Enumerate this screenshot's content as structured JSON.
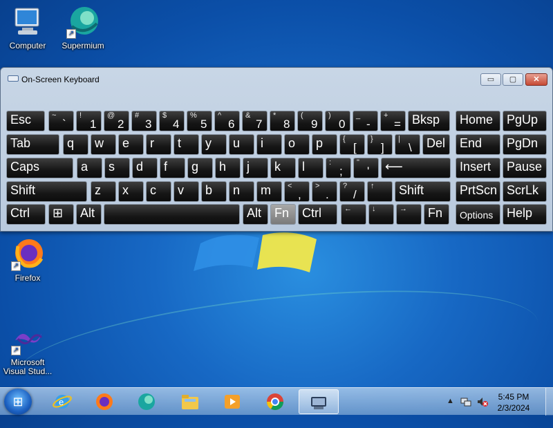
{
  "desktop": {
    "icons": [
      {
        "label": "Computer"
      },
      {
        "label": "Supermium"
      },
      {
        "label": "Firefox"
      },
      {
        "label": "Microsoft Visual Stud..."
      }
    ]
  },
  "osk": {
    "title": "On-Screen Keyboard",
    "controls": {
      "minimize": "▭",
      "maximize": "▢",
      "close": "✕"
    },
    "rows": [
      [
        {
          "main": "Esc"
        },
        {
          "top": "~",
          "bottom": "`"
        },
        {
          "top": "!",
          "bottom": "1"
        },
        {
          "top": "@",
          "bottom": "2"
        },
        {
          "top": "#",
          "bottom": "3"
        },
        {
          "top": "$",
          "bottom": "4"
        },
        {
          "top": "%",
          "bottom": "5"
        },
        {
          "top": "^",
          "bottom": "6"
        },
        {
          "top": "&",
          "bottom": "7"
        },
        {
          "top": "*",
          "bottom": "8"
        },
        {
          "top": "(",
          "bottom": "9"
        },
        {
          "top": ")",
          "bottom": "0"
        },
        {
          "top": "_",
          "bottom": "-"
        },
        {
          "top": "+",
          "bottom": "="
        },
        {
          "main": "Bksp"
        },
        {
          "main": "Home"
        },
        {
          "main": "PgUp"
        }
      ],
      [
        {
          "main": "Tab"
        },
        {
          "main": "q"
        },
        {
          "main": "w"
        },
        {
          "main": "e"
        },
        {
          "main": "r"
        },
        {
          "main": "t"
        },
        {
          "main": "y"
        },
        {
          "main": "u"
        },
        {
          "main": "i"
        },
        {
          "main": "o"
        },
        {
          "main": "p"
        },
        {
          "top": "{",
          "bottom": "["
        },
        {
          "top": "}",
          "bottom": "]"
        },
        {
          "top": "|",
          "bottom": "\\"
        },
        {
          "main": "Del"
        },
        {
          "main": "End"
        },
        {
          "main": "PgDn"
        }
      ],
      [
        {
          "main": "Caps"
        },
        {
          "main": "a"
        },
        {
          "main": "s"
        },
        {
          "main": "d"
        },
        {
          "main": "f"
        },
        {
          "main": "g"
        },
        {
          "main": "h"
        },
        {
          "main": "j"
        },
        {
          "main": "k"
        },
        {
          "main": "l"
        },
        {
          "top": ":",
          "bottom": ";"
        },
        {
          "top": "\"",
          "bottom": "'"
        },
        {
          "main": "⟵"
        },
        {
          "main": "Insert"
        },
        {
          "main": "Pause"
        }
      ],
      [
        {
          "main": "Shift"
        },
        {
          "main": "z"
        },
        {
          "main": "x"
        },
        {
          "main": "c"
        },
        {
          "main": "v"
        },
        {
          "main": "b"
        },
        {
          "main": "n"
        },
        {
          "main": "m"
        },
        {
          "top": "<",
          "bottom": ","
        },
        {
          "top": ">",
          "bottom": "."
        },
        {
          "top": "?",
          "bottom": "/"
        },
        {
          "top": "↑",
          "bottom": ""
        },
        {
          "main": "Shift"
        },
        {
          "main": "PrtScn"
        },
        {
          "main": "ScrLk"
        }
      ],
      [
        {
          "main": "Ctrl"
        },
        {
          "main": "⊞"
        },
        {
          "main": "Alt"
        },
        {
          "main": ""
        },
        {
          "main": "Alt"
        },
        {
          "main": "Fn"
        },
        {
          "main": "Ctrl"
        },
        {
          "top": "←",
          "bottom": ""
        },
        {
          "top": "↓",
          "bottom": ""
        },
        {
          "top": "→",
          "bottom": ""
        },
        {
          "main": "Fn"
        },
        {
          "main": "Options"
        },
        {
          "main": "Help"
        }
      ]
    ]
  },
  "taskbar": {
    "start_icon": "windows-orb",
    "apps": [
      "internet-explorer",
      "firefox",
      "supermium",
      "file-explorer",
      "media-player",
      "chrome",
      "on-screen-keyboard"
    ],
    "active_app": "on-screen-keyboard",
    "clock": {
      "time": "5:45 PM",
      "date": "2/3/2024"
    },
    "tray": {
      "expand": "▲",
      "network": "network-icon",
      "volume": "volume-muted-icon"
    }
  },
  "colors": {
    "accent": "#1768c4",
    "key_bg": "#161616",
    "close_red": "#c64a34"
  }
}
